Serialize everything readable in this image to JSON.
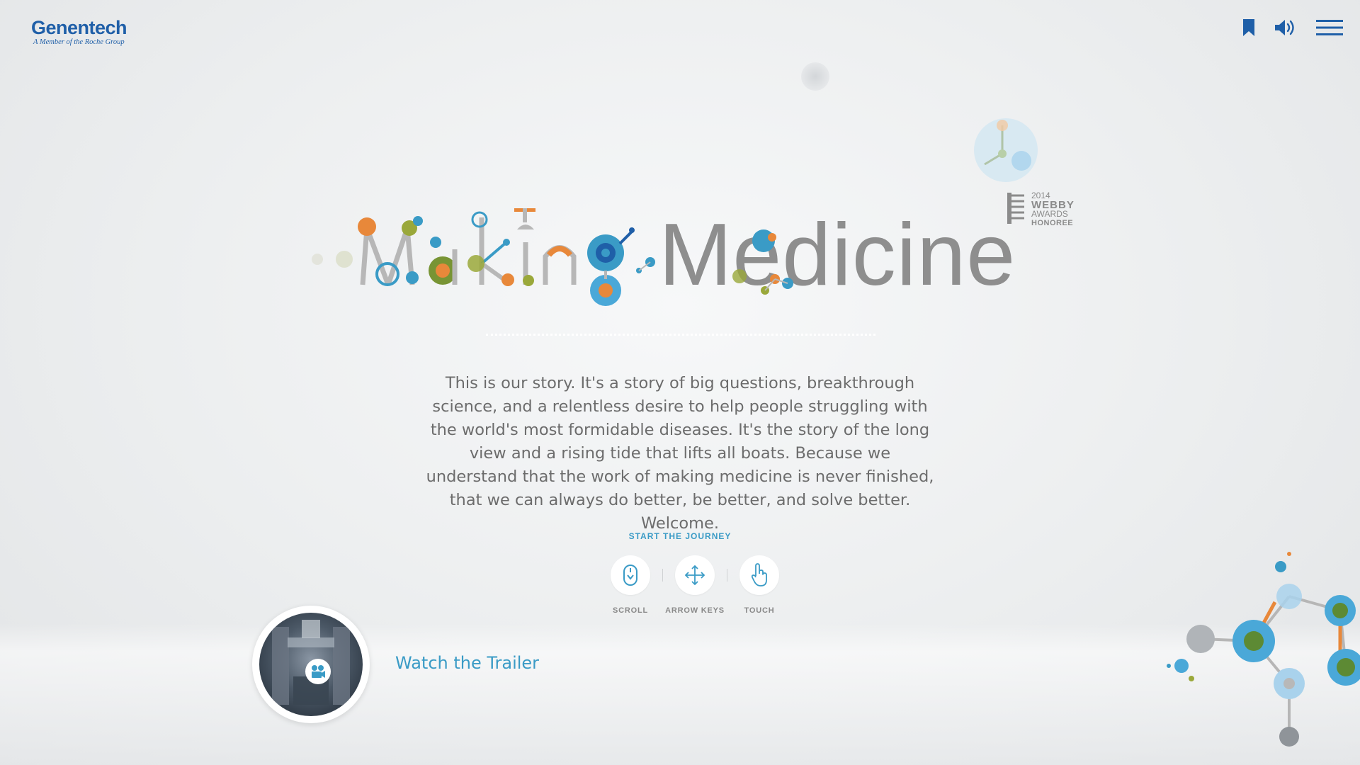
{
  "header": {
    "logo_main": "Genentech",
    "logo_sub": "A Member of the Roche Group",
    "icons": [
      "bookmark-icon",
      "speaker-icon",
      "menu-icon"
    ]
  },
  "hero": {
    "title_part1": "Making",
    "title_part2": "Medicine",
    "award": {
      "year": "2014",
      "name": "WEBBY",
      "line2": "AWARDS",
      "line3": "HONOREE"
    },
    "story": "This is our story. It's a story of big questions, breakthrough science, and a relentless desire to help people struggling with the world's most formidable diseases. It's the story of the long view and a rising tide that lifts all boats. Because we understand that the work of making medicine is never finished, that we can always do better, be better, and solve better. Welcome."
  },
  "journey": {
    "label": "START THE JOURNEY",
    "controls": [
      {
        "label": "SCROLL",
        "icon": "mouse-icon"
      },
      {
        "label": "ARROW KEYS",
        "icon": "arrows-icon"
      },
      {
        "label": "TOUCH",
        "icon": "hand-icon"
      }
    ]
  },
  "trailer": {
    "label": "Watch the Trailer",
    "icon": "video-camera-icon"
  },
  "colors": {
    "brand_blue": "#1f5fa8",
    "accent_blue": "#3a9bc6",
    "orange": "#e8883a",
    "olive": "#9aa83a",
    "text_gray": "#6c6c6c"
  }
}
